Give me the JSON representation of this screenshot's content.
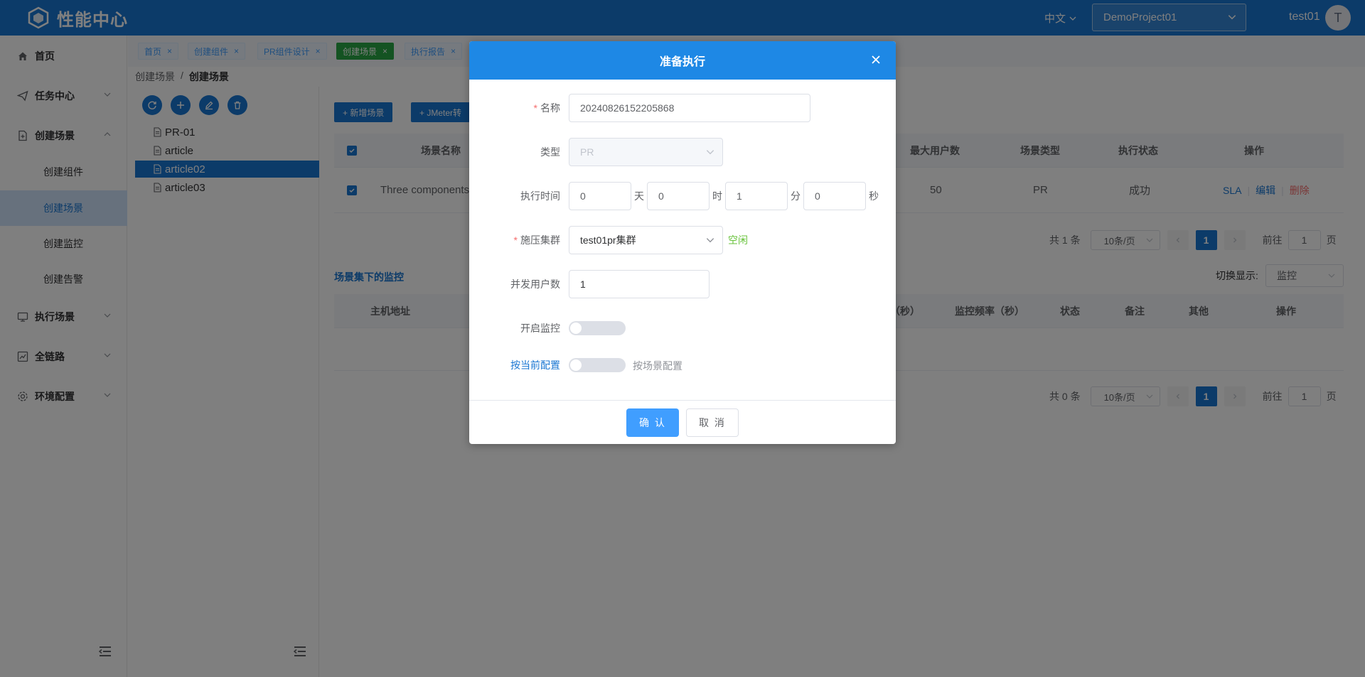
{
  "header": {
    "logo_text": "性能中心",
    "language": "中文",
    "project": "DemoProject01",
    "user": "test01",
    "avatar_letter": "T"
  },
  "sidebar": {
    "items": [
      {
        "label": "首页",
        "icon": "home-icon"
      },
      {
        "label": "任务中心",
        "icon": "send-icon"
      },
      {
        "label": "创建场景",
        "icon": "file-plus-icon"
      },
      {
        "label": "执行场景",
        "icon": "monitor-icon"
      },
      {
        "label": "全链路",
        "icon": "chart-icon"
      },
      {
        "label": "环境配置",
        "icon": "gear-icon"
      }
    ],
    "sub_items": [
      "创建组件",
      "创建场景",
      "创建监控",
      "创建告警"
    ]
  },
  "tabs": [
    "首页",
    "创建组件",
    "PR组件设计",
    "创建场景",
    "执行报告"
  ],
  "breadcrumb": {
    "parent": "创建场景",
    "current": "创建场景"
  },
  "tree": {
    "nodes": [
      "PR-01",
      "article",
      "article02",
      "article03"
    ]
  },
  "main": {
    "btn_new": "+ 新增场景",
    "btn_jmeter": "+ JMeter转",
    "scene_table": {
      "headers": {
        "name": "场景名称",
        "max_users": "最大用户数",
        "scene_type": "场景类型",
        "exec_status": "执行状态",
        "actions": "操作"
      },
      "row": {
        "name": "Three components",
        "max_users": "50",
        "scene_type": "PR",
        "exec_status": "成功",
        "sla": "SLA",
        "edit": "编辑",
        "delete": "删除"
      }
    },
    "pager1": {
      "total": "共 1 条",
      "page_size": "10条/页",
      "page": "1",
      "goto": "前往",
      "goto_val": "1",
      "page_unit": "页"
    },
    "monitor_title": "场景集下的监控",
    "switch_label": "切换显示:",
    "switch_value": "监控",
    "monitor_table": {
      "headers": {
        "host": "主机地址",
        "duration": "（秒）",
        "freq": "监控频率（秒）",
        "status": "状态",
        "remark": "备注",
        "other": "其他",
        "actions": "操作"
      }
    },
    "pager2": {
      "total": "共 0 条",
      "page_size": "10条/页",
      "page": "1",
      "goto": "前往",
      "goto_val": "1",
      "page_unit": "页"
    }
  },
  "modal": {
    "title": "准备执行",
    "name_label": "名称",
    "name_value": "20240826152205868",
    "type_label": "类型",
    "type_value": "PR",
    "time_label": "执行时间",
    "time": {
      "days": "0",
      "days_unit": "天",
      "hours": "0",
      "hours_unit": "时",
      "minutes": "1",
      "minutes_unit": "分",
      "seconds": "0",
      "seconds_unit": "秒"
    },
    "cluster_label": "施压集群",
    "cluster_value": "test01pr集群",
    "cluster_status": "空闲",
    "users_label": "并发用户数",
    "users_value": "1",
    "monitor_label": "开启监控",
    "config_label": "按当前配置",
    "config_alt": "按场景配置",
    "confirm": "确 认",
    "cancel": "取 消"
  },
  "colors": {
    "primary": "#1976d2",
    "modal_header": "#1e88e5",
    "success": "#67c23a",
    "danger": "#f56c6c"
  }
}
